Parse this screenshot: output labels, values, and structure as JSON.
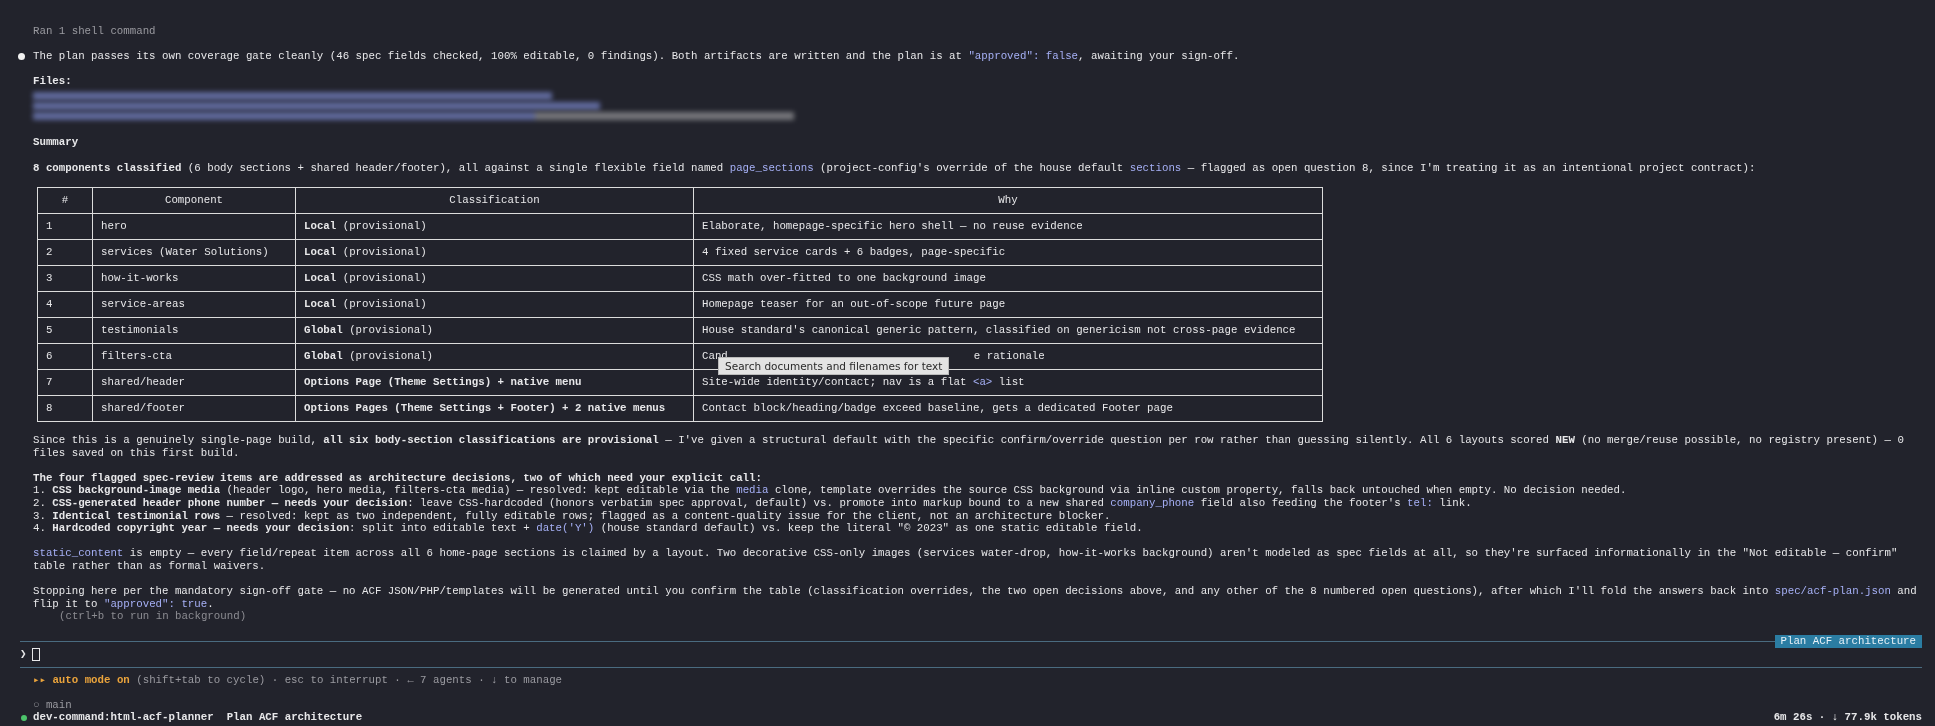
{
  "tool_status": "Ran 1 shell command",
  "intro": [
    {
      "kind": "plain",
      "text": "The plan passes its own coverage gate cleanly (46 spec fields checked, 100% editable, 0 findings). Both artifacts are written and the plan is at "
    },
    {
      "kind": "code",
      "text": "\"approved\": false"
    },
    {
      "kind": "plain",
      "text": ", awaiting your sign-off."
    }
  ],
  "files_heading": "Files:",
  "summary_heading": "Summary",
  "summary": [
    {
      "kind": "bold",
      "text": "8 components classified"
    },
    {
      "kind": "plain",
      "text": " (6 body sections + shared header/footer), all against a single flexible field named "
    },
    {
      "kind": "code",
      "text": "page_sections"
    },
    {
      "kind": "plain",
      "text": " (project-config's override of the house default "
    },
    {
      "kind": "code",
      "text": "sections"
    },
    {
      "kind": "plain",
      "text": " — flagged as open question 8, since I'm treating it as an intentional project contract):"
    }
  ],
  "table": {
    "columns": [
      "#",
      "Component",
      "Classification",
      "Why"
    ],
    "rows": [
      {
        "num": "1",
        "component": "hero",
        "classification": "**Local** (provisional)",
        "why": [
          {
            "kind": "plain",
            "text": "Elaborate, homepage-specific hero shell — no reuse evidence"
          }
        ]
      },
      {
        "num": "2",
        "component": "services (Water Solutions)",
        "classification": "**Local** (provisional)",
        "why": [
          {
            "kind": "plain",
            "text": "4 fixed service cards + 6 badges, page-specific"
          }
        ]
      },
      {
        "num": "3",
        "component": "how-it-works",
        "classification": "**Local** (provisional)",
        "why": [
          {
            "kind": "plain",
            "text": "CSS math over-fitted to one background image"
          }
        ]
      },
      {
        "num": "4",
        "component": "service-areas",
        "classification": "**Local** (provisional)",
        "why": [
          {
            "kind": "plain",
            "text": "Homepage teaser for an out-of-scope future page"
          }
        ]
      },
      {
        "num": "5",
        "component": "testimonials",
        "classification": "**Global** (provisional)",
        "why": [
          {
            "kind": "plain",
            "text": "House standard's canonical generic pattern, classified on genericism not cross-page evidence"
          }
        ]
      },
      {
        "num": "6",
        "component": "filters-cta",
        "classification": "**Global** (provisional)",
        "why": [
          {
            "kind": "plain",
            "text": "Cand"
          },
          {
            "kind": "plain",
            "text": "e rationale"
          }
        ],
        "tooltip": "Search documents and filenames for text"
      },
      {
        "num": "7",
        "component": "shared/header",
        "classification": "**Options Page (Theme Settings) + native menu**",
        "why": [
          {
            "kind": "plain",
            "text": "Site-wide identity/contact; nav is a flat "
          },
          {
            "kind": "code",
            "text": "<a>"
          },
          {
            "kind": "plain",
            "text": " list"
          }
        ]
      },
      {
        "num": "8",
        "component": "shared/footer",
        "classification": "**Options Pages (Theme Settings + Footer) + 2 native menus**",
        "why": [
          {
            "kind": "plain",
            "text": "Contact block/heading/badge exceed baseline, gets a dedicated Footer page"
          }
        ]
      }
    ]
  },
  "blocks": [
    {
      "kind": "paragraph",
      "segments": [
        {
          "kind": "plain",
          "text": "Since this is a genuinely single-page build, "
        },
        {
          "kind": "bold",
          "text": "all six body-section classifications are provisional"
        },
        {
          "kind": "plain",
          "text": " — I've given a structural default with the specific confirm/override question per row rather than guessing silently. All 6 layouts scored "
        },
        {
          "kind": "bold",
          "text": "NEW"
        },
        {
          "kind": "plain",
          "text": " (no merge/reuse possible, no registry present) — 0 files saved on this first build."
        }
      ]
    },
    {
      "kind": "list",
      "heading": "The four flagged spec-review items are addressed as architecture decisions, two of which need your explicit call:",
      "items": [
        [
          {
            "kind": "plain",
            "text": "1. "
          },
          {
            "kind": "bold",
            "text": "CSS background-image media"
          },
          {
            "kind": "plain",
            "text": " (header logo, hero media, filters-cta media) — resolved: kept editable via the "
          },
          {
            "kind": "code",
            "text": "media"
          },
          {
            "kind": "plain",
            "text": " clone, template overrides the source CSS background via inline custom property, falls back untouched when empty. No decision needed."
          }
        ],
        [
          {
            "kind": "plain",
            "text": "2. "
          },
          {
            "kind": "bold",
            "text": "CSS-generated header phone number — needs your decision"
          },
          {
            "kind": "plain",
            "text": ": leave CSS-hardcoded (honors verbatim spec approval, default) vs. promote into markup bound to a new shared "
          },
          {
            "kind": "code",
            "text": "company_phone"
          },
          {
            "kind": "plain",
            "text": " field also feeding the footer's "
          },
          {
            "kind": "code",
            "text": "tel:"
          },
          {
            "kind": "plain",
            "text": " link."
          }
        ],
        [
          {
            "kind": "plain",
            "text": "3. "
          },
          {
            "kind": "bold",
            "text": "Identical testimonial rows"
          },
          {
            "kind": "plain",
            "text": " — resolved: kept as two independent, fully editable rows; flagged as a content-quality issue for the client, not an architecture blocker."
          }
        ],
        [
          {
            "kind": "plain",
            "text": "4. "
          },
          {
            "kind": "bold",
            "text": "Hardcoded copyright year — needs your decision"
          },
          {
            "kind": "plain",
            "text": ": split into editable text + "
          },
          {
            "kind": "code",
            "text": "date('Y')"
          },
          {
            "kind": "plain",
            "text": " (house standard default) vs. keep the literal \"© 2023\" as one static editable field."
          }
        ]
      ]
    },
    {
      "kind": "paragraph",
      "segments": [
        {
          "kind": "code",
          "text": "static_content"
        },
        {
          "kind": "plain",
          "text": " is empty — every field/repeat item across all 6 home-page sections is claimed by a layout. Two decorative CSS-only images (services water-drop, how-it-works background) aren't modeled as spec fields at all, so they're surfaced informationally in the \"Not editable — confirm\" table rather than as formal waivers."
        }
      ]
    },
    {
      "kind": "paragraph",
      "segments": [
        {
          "kind": "plain",
          "text": "Stopping here per the mandatory sign-off gate — no ACF JSON/PHP/templates will be generated until you confirm the table (classification overrides, the two open decisions above, and any other of the 8 numbered open questions), after which I'll fold the answers back into "
        },
        {
          "kind": "code",
          "text": "spec/acf-plan.json"
        },
        {
          "kind": "plain",
          "text": " and flip it to "
        },
        {
          "kind": "code",
          "text": "\"approved\": true"
        },
        {
          "kind": "plain",
          "text": "."
        }
      ]
    }
  ],
  "hint": "(ctrl+b to run in background)",
  "task_tag": "Plan ACF architecture",
  "prompt_symbol": "❯",
  "mode": {
    "label": "▸▸ auto mode on",
    "hints": "(shift+tab to cycle) · esc to interrupt · ← 7 agents · ↓ to manage"
  },
  "footer": {
    "branch": "○ main",
    "session": "dev-command:html-acf-planner",
    "task": "Plan ACF architecture",
    "stats": "6m 26s · ↓ 77.9k tokens"
  }
}
